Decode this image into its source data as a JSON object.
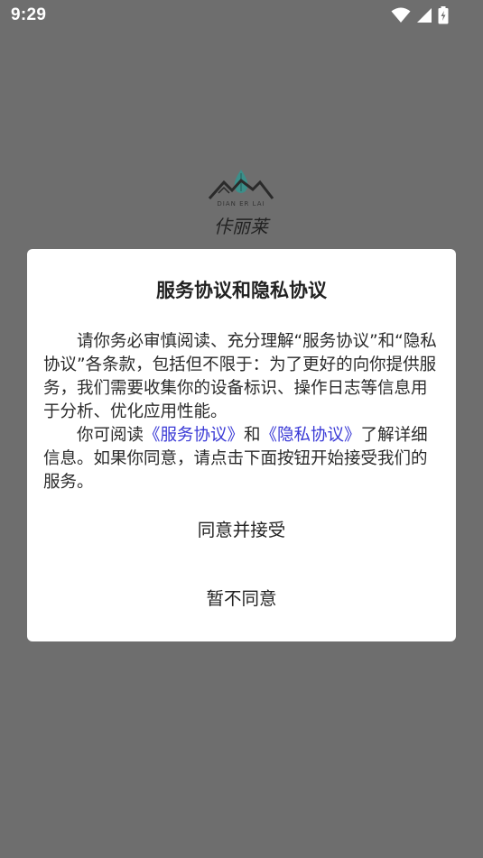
{
  "status_bar": {
    "time": "9:29",
    "icons": [
      "wifi-icon",
      "cellular-signal-icon",
      "battery-charging-icon"
    ]
  },
  "logo": {
    "latin_text": "DIAN ER LAI",
    "characters": "佧丽莱"
  },
  "dialog": {
    "title": "服务协议和隐私协议",
    "paragraph1": "请你务必审慎阅读、充分理解“服务协议”和“隐私协议”各条款，包括但不限于：为了更好的向你提供服务，我们需要收集你的设备标识、操作日志等信息用于分析、优化应用性能。",
    "paragraph2_prefix": "你可阅读",
    "service_link": "《服务协议》",
    "paragraph2_and": "和",
    "privacy_link": "《隐私协议》",
    "paragraph2_suffix": "了解详细信息。如果你同意，请点击下面按钮开始接受我们的服务。",
    "accept_label": "同意并接受",
    "decline_label": "暂不同意"
  },
  "colors": {
    "overlay": "#6e6e6e",
    "dialog_bg": "#ffffff",
    "link": "#3a3ad6"
  }
}
